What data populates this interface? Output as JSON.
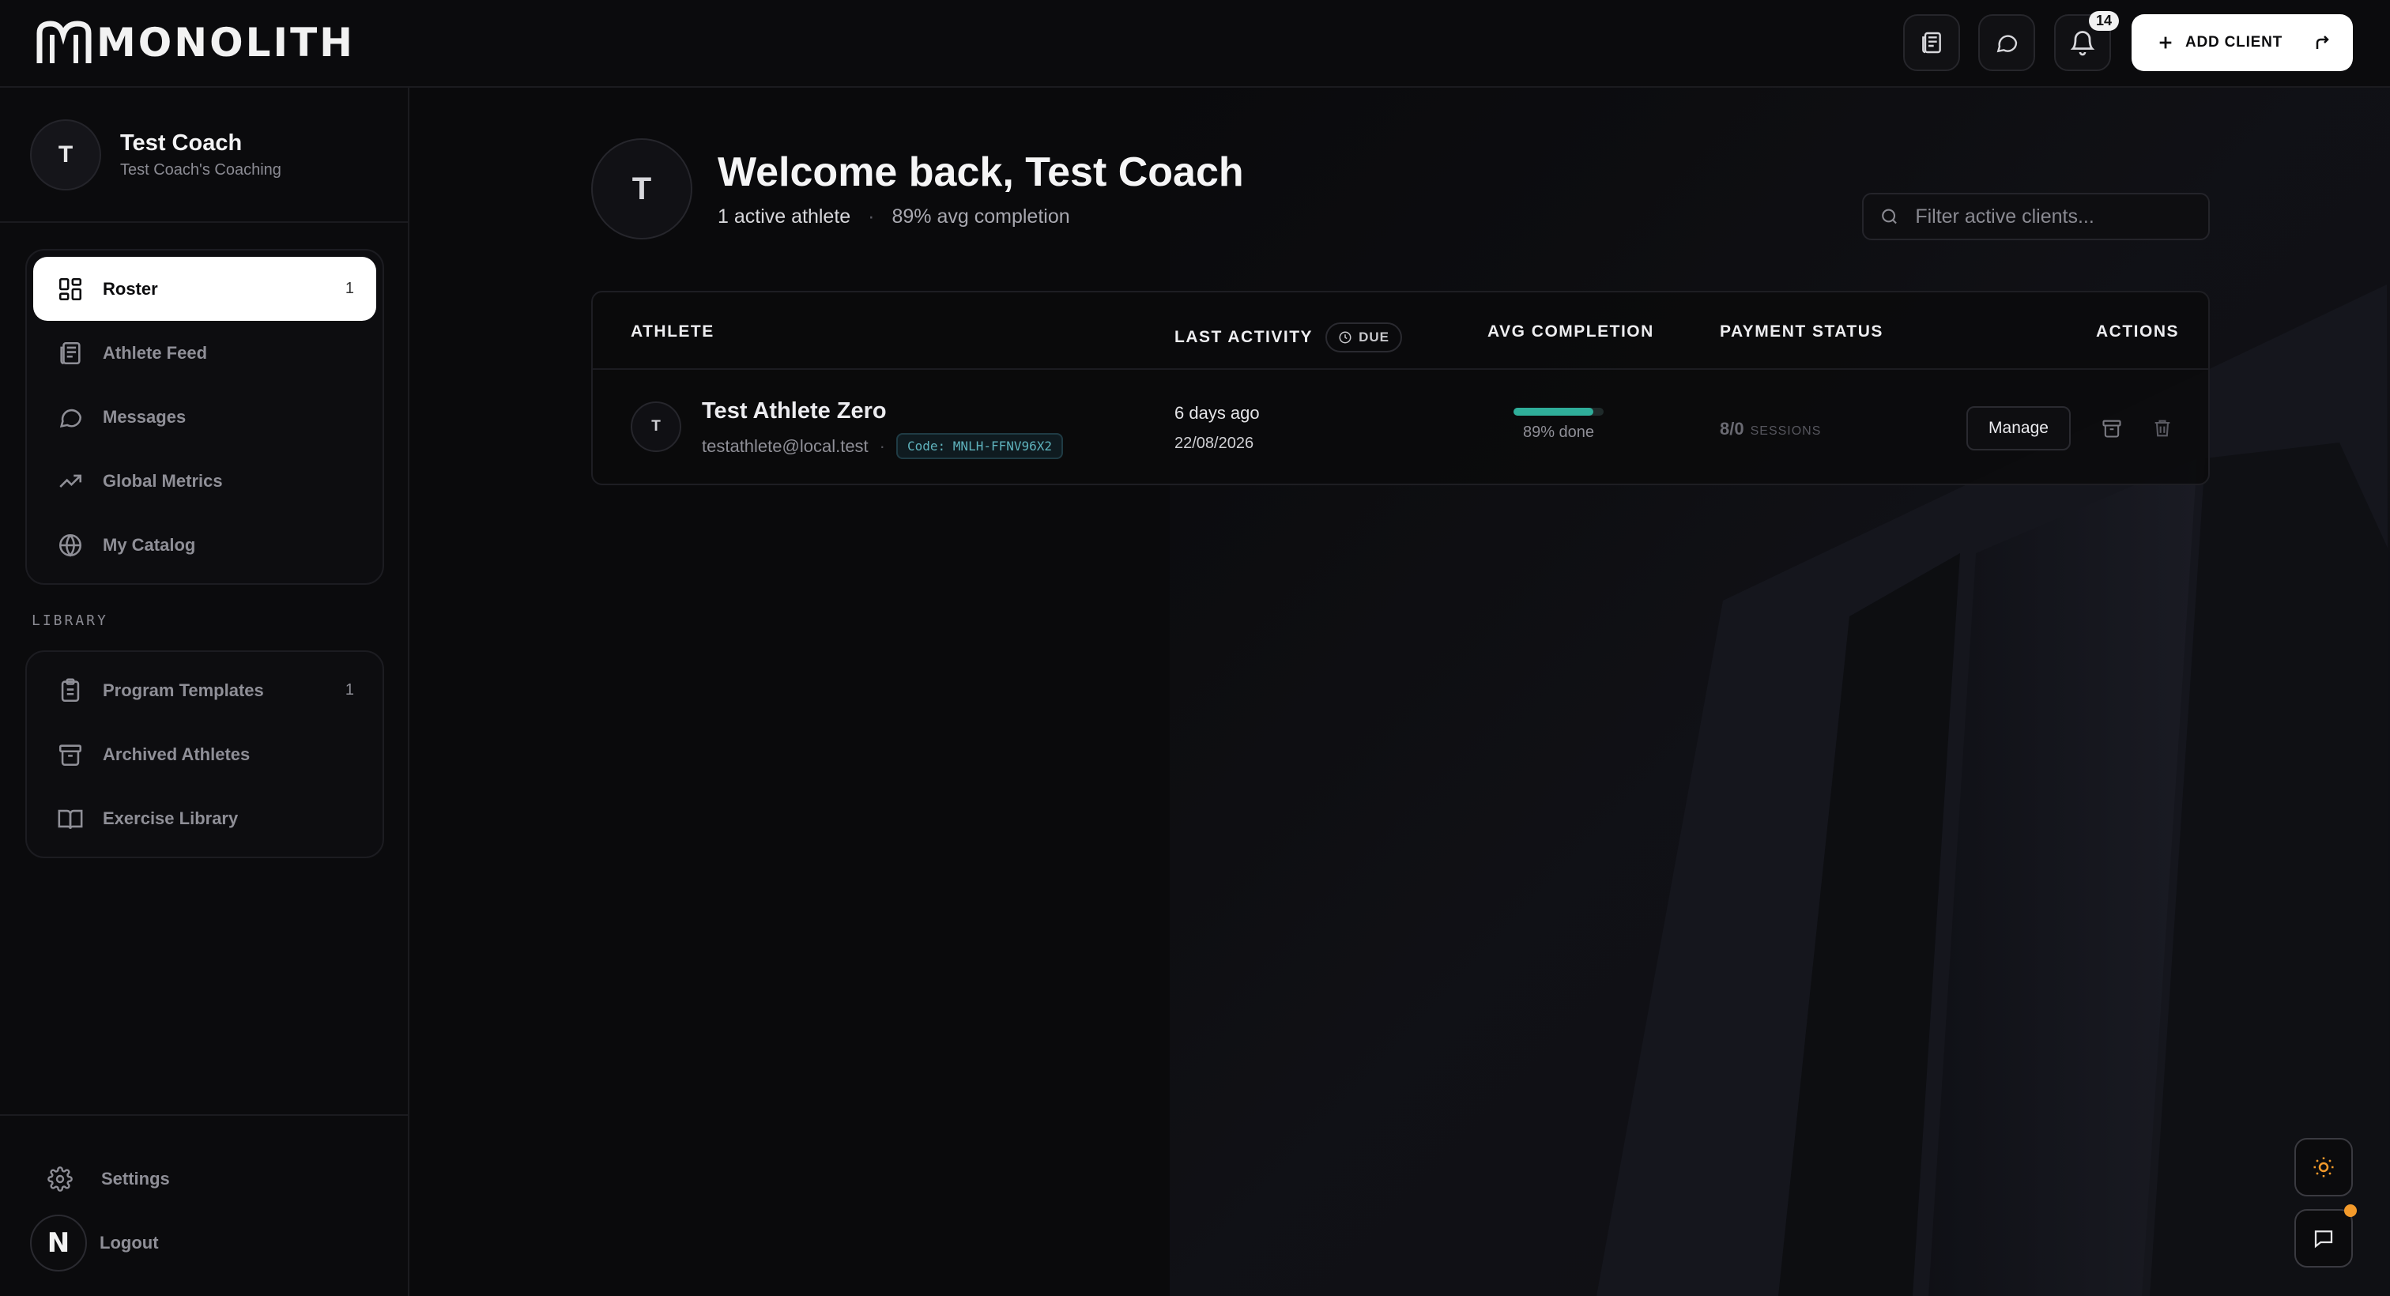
{
  "app": {
    "name": "MONOLITH"
  },
  "topbar": {
    "notifications_count": "14",
    "add_client_label": "ADD CLIENT"
  },
  "profile": {
    "initial": "T",
    "name": "Test Coach",
    "subtitle": "Test Coach's Coaching"
  },
  "nav": {
    "items": [
      {
        "label": "Roster",
        "count": "1",
        "icon": "grid-icon",
        "active": true
      },
      {
        "label": "Athlete Feed",
        "count": "",
        "icon": "newspaper-icon"
      },
      {
        "label": "Messages",
        "count": "",
        "icon": "message-icon"
      },
      {
        "label": "Global Metrics",
        "count": "",
        "icon": "trend-icon"
      },
      {
        "label": "My Catalog",
        "count": "",
        "icon": "globe-icon"
      }
    ],
    "library_label": "LIBRARY",
    "library_items": [
      {
        "label": "Program Templates",
        "count": "1",
        "icon": "clipboard-icon"
      },
      {
        "label": "Archived Athletes",
        "count": "",
        "icon": "archive-icon"
      },
      {
        "label": "Exercise Library",
        "count": "",
        "icon": "book-icon"
      }
    ],
    "settings_label": "Settings",
    "logout_label": "Logout",
    "logout_badge": "N"
  },
  "main": {
    "avatar_initial": "T",
    "welcome": "Welcome back, Test Coach",
    "active_athletes": "1 active athlete",
    "avg_completion": "89% avg completion",
    "filter_placeholder": "Filter active clients..."
  },
  "table": {
    "headers": {
      "athlete": "ATHLETE",
      "last_activity": "LAST ACTIVITY",
      "due": "DUE",
      "avg_completion": "AVG COMPLETION",
      "payment_status": "PAYMENT STATUS",
      "actions": "ACTIONS"
    },
    "rows": [
      {
        "initial": "T",
        "name": "Test Athlete Zero",
        "email": "testathlete@local.test",
        "code": "Code: MNLH-FFNV96X2",
        "last_activity": "6 days ago",
        "last_date": "22/08/2026",
        "completion_fraction": 0.89,
        "completion_label": "89% done",
        "payment": "8/0",
        "payment_unit": "SESSIONS",
        "manage_label": "Manage"
      }
    ]
  },
  "colors": {
    "accent": "#2fae9a",
    "background": "#0a0a0c",
    "chat_dot": "#f39a2b"
  }
}
